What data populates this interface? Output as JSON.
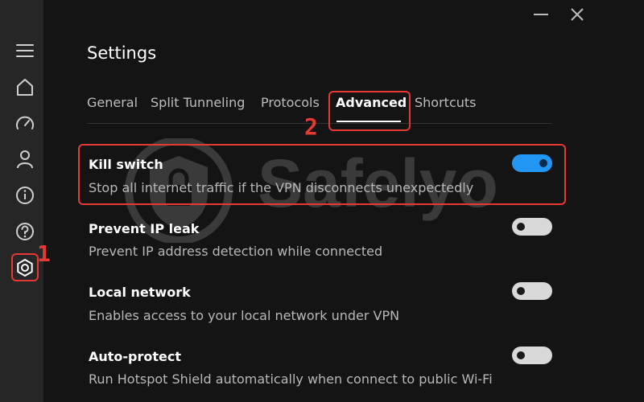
{
  "window": {
    "minimize_icon": "minimize-icon",
    "close_icon": "close-icon"
  },
  "sidebar": {
    "items": [
      {
        "icon": "menu-icon"
      },
      {
        "icon": "home-icon"
      },
      {
        "icon": "speedometer-icon"
      },
      {
        "icon": "user-icon"
      },
      {
        "icon": "info-icon"
      },
      {
        "icon": "help-icon"
      },
      {
        "icon": "settings-icon",
        "active": true
      }
    ]
  },
  "annotations": {
    "step1": "1",
    "step2": "2",
    "color": "#e53935"
  },
  "page": {
    "title": "Settings"
  },
  "tabs": [
    {
      "label": "General"
    },
    {
      "label": "Split Tunneling"
    },
    {
      "label": "Protocols"
    },
    {
      "label": "Advanced",
      "active": true
    },
    {
      "label": "Shortcuts"
    }
  ],
  "settings": [
    {
      "title": "Kill switch",
      "description": "Stop all internet traffic if the VPN disconnects unexpectedly",
      "enabled": true
    },
    {
      "title": "Prevent IP leak",
      "description": "Prevent IP address detection while connected",
      "enabled": false
    },
    {
      "title": "Local network",
      "description": "Enables access to your local network under VPN",
      "enabled": false
    },
    {
      "title": "Auto-protect",
      "description": "Run Hotspot Shield automatically when connect to public Wi-Fi",
      "enabled": false
    }
  ],
  "watermark": {
    "text": "Safelyo"
  },
  "colors": {
    "background": "#141414",
    "sidebar": "#262626",
    "toggle_on": "#2196f3",
    "toggle_off": "#d9d9d9"
  }
}
